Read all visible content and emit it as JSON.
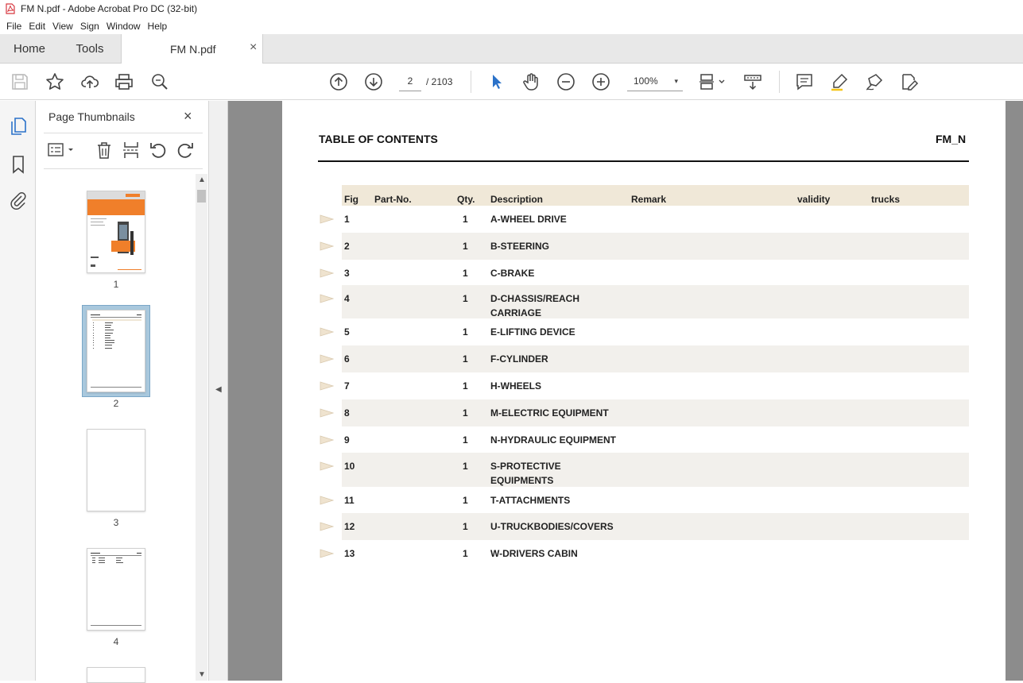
{
  "window": {
    "title": "FM N.pdf - Adobe Acrobat Pro DC (32-bit)"
  },
  "menu": [
    "File",
    "Edit",
    "View",
    "Sign",
    "Window",
    "Help"
  ],
  "tabs": {
    "home": "Home",
    "tools": "Tools",
    "doc": "FM N.pdf",
    "close": "×"
  },
  "toolbar": {
    "page_current": "2",
    "page_total": "/  2103",
    "zoom": "100%",
    "zoom_caret": "▾"
  },
  "thumbnails": {
    "title": "Page Thumbnails",
    "close": "×",
    "pages": [
      "1",
      "2",
      "3",
      "4"
    ]
  },
  "document": {
    "title": "TABLE OF CONTENTS",
    "code": "FM_N",
    "columns": {
      "fig": "Fig",
      "part": "Part-No.",
      "qty": "Qty.",
      "desc": "Description",
      "remark": "Remark",
      "validity": "validity",
      "trucks": "trucks"
    },
    "rows": [
      {
        "fig": "1",
        "qty": "1",
        "desc": "A-WHEEL DRIVE"
      },
      {
        "fig": "2",
        "qty": "1",
        "desc": "B-STEERING"
      },
      {
        "fig": "3",
        "qty": "1",
        "desc": "C-BRAKE"
      },
      {
        "fig": "4",
        "qty": "1",
        "desc": "D-CHASSIS/REACH",
        "desc2": "CARRIAGE"
      },
      {
        "fig": "5",
        "qty": "1",
        "desc": "E-LIFTING DEVICE"
      },
      {
        "fig": "6",
        "qty": "1",
        "desc": "F-CYLINDER"
      },
      {
        "fig": "7",
        "qty": "1",
        "desc": "H-WHEELS"
      },
      {
        "fig": "8",
        "qty": "1",
        "desc": "M-ELECTRIC EQUIPMENT"
      },
      {
        "fig": "9",
        "qty": "1",
        "desc": "N-HYDRAULIC EQUIPMENT"
      },
      {
        "fig": "10",
        "qty": "1",
        "desc": "S-PROTECTIVE",
        "desc2": "EQUIPMENTS"
      },
      {
        "fig": "11",
        "qty": "1",
        "desc": "T-ATTACHMENTS"
      },
      {
        "fig": "12",
        "qty": "1",
        "desc": "U-TRUCKBODIES/COVERS"
      },
      {
        "fig": "13",
        "qty": "1",
        "desc": "W-DRIVERS CABIN"
      }
    ]
  },
  "colors": {
    "header_bg": "#f0e8d8",
    "row_shade": "#f2f0ec",
    "acrobat_red": "#d7373f",
    "select_blue": "#2b72c9"
  }
}
